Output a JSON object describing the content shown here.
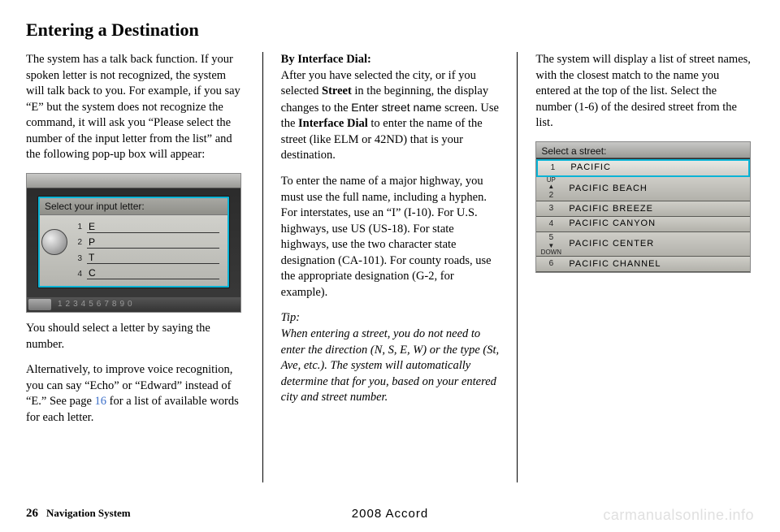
{
  "title": "Entering a Destination",
  "col1": {
    "p1": "The system has a talk back function. If your spoken letter is not recognized, the system will talk back to you. For example, if you say “E” but the system does not recognize the command, it will ask you “Please select the number of the input letter from the list” and the following pop-up box will appear:",
    "popup_title": "Select your input letter:",
    "letters": [
      "E",
      "P",
      "T",
      "C"
    ],
    "nums": [
      "1",
      "2",
      "3",
      "4"
    ],
    "keystrip": "1234567890",
    "p2": "You should select a letter by saying the number.",
    "p3a": "Alternatively, to improve voice recognition, you can say “Echo” or “Edward” instead of “E.” See page ",
    "p3link": "16",
    "p3b": " for a list of available words for each letter."
  },
  "col2": {
    "h": "By Interface Dial:",
    "p1a": "After you have selected the city, or if you selected ",
    "p1b": "Street",
    "p1c": " in the beginning, the display changes to the ",
    "p1d": "Enter street name",
    "p1e": " screen. Use the ",
    "p1f": "Interface Dial",
    "p1g": " to enter the name of the street (like ELM or 42ND) that is your destination.",
    "p2": "To enter the name of a major highway, you must use the full name, including a hyphen. For interstates, use an “I” (I-10). For U.S. highways, use US (US-18). For state highways, use the two character state designation (CA-101). For county roads, use the appropriate designation (G-2, for example).",
    "tiph": "Tip:",
    "tip": "When entering a street, you do not need to enter the direction (N, S, E, W) or the type (St, Ave, etc.). The system will automatically determine that for you, based on your entered city and street number."
  },
  "col3": {
    "p1": "The system will display a list of street names, with the closest match to the name you entered at the top of the list. Select the number (1-6) of the desired street from the list.",
    "shot_title": "Select a street:",
    "rows": [
      {
        "n": "1",
        "t": "PACIFIC"
      },
      {
        "n": "2",
        "t": "PACIFIC BEACH"
      },
      {
        "n": "3",
        "t": "PACIFIC BREEZE"
      },
      {
        "n": "4",
        "t": "PACIFIC CANYON"
      },
      {
        "n": "5",
        "t": "PACIFIC CENTER"
      },
      {
        "n": "6",
        "t": "PACIFIC CHANNEL"
      }
    ],
    "up": "UP",
    "down": "DOWN"
  },
  "footer": {
    "page": "26",
    "section": "Navigation System",
    "car": "2008  Accord",
    "wm": "carmanualsonline.info"
  }
}
